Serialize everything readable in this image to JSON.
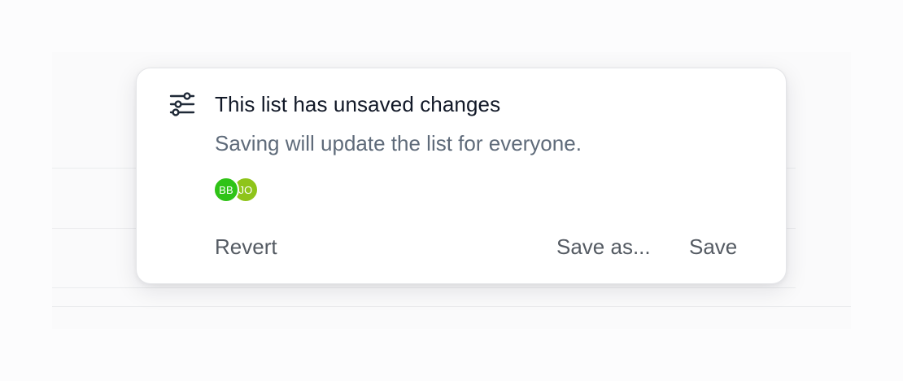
{
  "popover": {
    "icon": "sliders-icon",
    "title": "This list has unsaved changes",
    "subtitle": "Saving will update the list for everyone.",
    "avatars": [
      {
        "initials": "BB",
        "color": "#2fc317"
      },
      {
        "initials": "JO",
        "color": "#8fc41a"
      }
    ],
    "actions": {
      "revert_label": "Revert",
      "save_as_label": "Save as...",
      "save_label": "Save"
    }
  },
  "colors": {
    "title": "#111827",
    "subtitle": "#5f6b7a",
    "action_text": "#555b63"
  }
}
